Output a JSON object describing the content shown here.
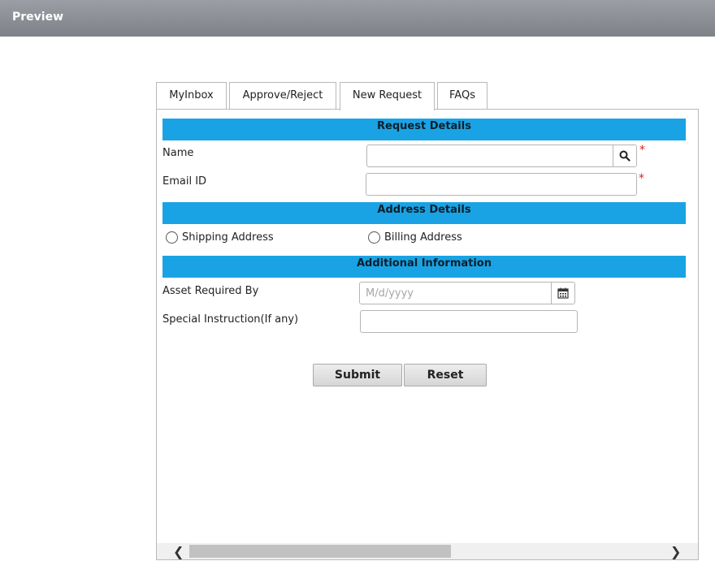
{
  "window": {
    "title": "Preview"
  },
  "tabs": [
    {
      "label": "MyInbox"
    },
    {
      "label": "Approve/Reject"
    },
    {
      "label": "New Request"
    },
    {
      "label": "FAQs"
    }
  ],
  "active_tab": "New Request",
  "sections": {
    "request_details": "Request Details",
    "address_details": "Address Details",
    "additional_info": "Additional Information"
  },
  "fields": {
    "name": {
      "label": "Name",
      "value": "",
      "required_mark": "*"
    },
    "email": {
      "label": "Email ID",
      "value": "",
      "required_mark": "*"
    },
    "asset_required_by": {
      "label": "Asset Required By",
      "value": "",
      "placeholder": "M/d/yyyy"
    },
    "special_instruction": {
      "label": "Special Instruction(If any)",
      "value": ""
    }
  },
  "address_options": [
    {
      "label": "Shipping Address",
      "selected": false
    },
    {
      "label": "Billing Address",
      "selected": false
    }
  ],
  "buttons": {
    "submit": "Submit",
    "reset": "Reset"
  },
  "icons": {
    "name_lookup": "search-icon",
    "date_picker": "calendar-icon",
    "scroll_left": "chevron-left-icon",
    "scroll_right": "chevron-right-icon"
  },
  "colors": {
    "section_bar": "#1aa3e4",
    "required": "#e02020",
    "titlebar": "#8a8d93"
  }
}
